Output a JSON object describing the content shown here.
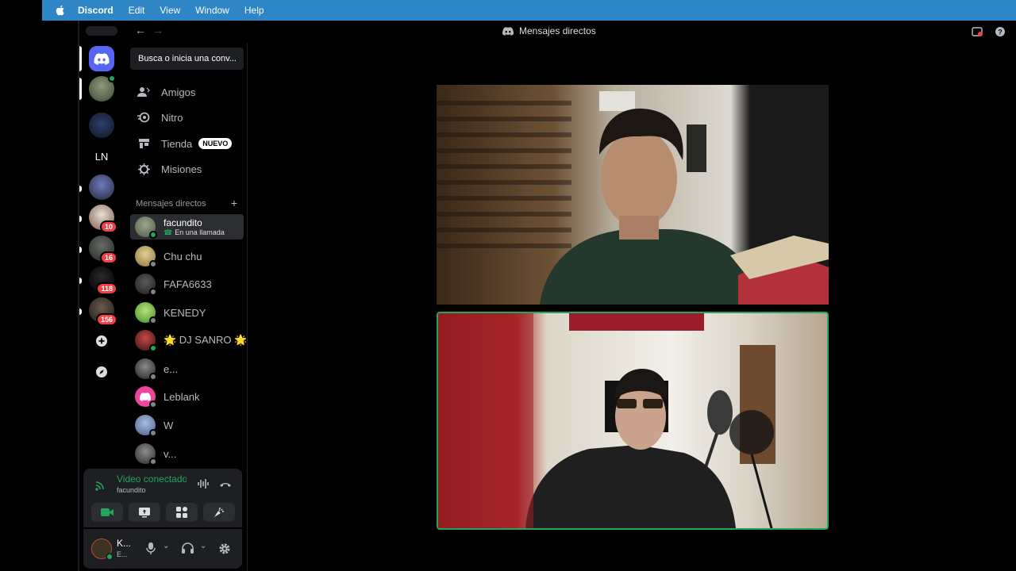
{
  "menubar": {
    "app": "Discord",
    "items": [
      "Edit",
      "View",
      "Window",
      "Help"
    ]
  },
  "titlebar": {
    "title": "Mensajes directos"
  },
  "servers": {
    "ln_label": "LN",
    "badges": [
      "10",
      "16",
      "118",
      "156"
    ]
  },
  "sidebar": {
    "search_placeholder": "Busca o inicia una conv...",
    "nav": [
      {
        "label": "Amigos",
        "icon": "friends-icon"
      },
      {
        "label": "Nitro",
        "icon": "nitro-icon"
      },
      {
        "label": "Tienda",
        "icon": "shop-icon",
        "badge": "NUEVO"
      },
      {
        "label": "Misiones",
        "icon": "quests-icon"
      }
    ],
    "dm_header": "Mensajes directos",
    "dms": [
      {
        "name": "facundito",
        "status": "En una llamada",
        "color": "#6b7d63",
        "online": true
      },
      {
        "name": "Chu chu",
        "color": "#c9b27a",
        "online": false
      },
      {
        "name": "FAFA6633",
        "color": "#4a4a4a",
        "online": false
      },
      {
        "name": "KENEDY",
        "color": "#73c35a",
        "online": false
      },
      {
        "name": "🌟 DJ SANRO 🌟",
        "color": "#8a2a2a",
        "online": true
      },
      {
        "name": "e...",
        "color": "#3a3a3a",
        "online": false
      },
      {
        "name": "Leblank",
        "color": "#eb459e",
        "online": false
      },
      {
        "name": "W",
        "color": "#6d86b5",
        "online": false
      },
      {
        "name": "v...",
        "color": "#555555",
        "online": false
      }
    ]
  },
  "voice": {
    "title": "Video conectado",
    "subtitle": "facundito"
  },
  "user": {
    "name": "K...",
    "status": "E..."
  },
  "colors": {
    "accent": "#5865f2",
    "green": "#23a55a",
    "red": "#f23f43",
    "menubar": "#2f86c6"
  }
}
